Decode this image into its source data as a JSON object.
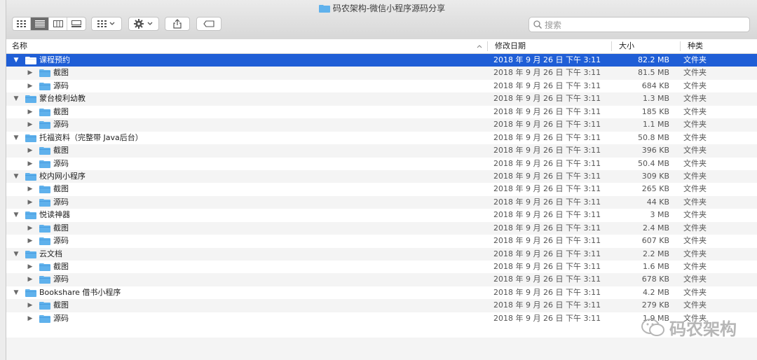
{
  "window": {
    "title": "码农架构-微信小程序源码分享"
  },
  "toolbar": {
    "search_placeholder": "搜索"
  },
  "columns": {
    "name": "名称",
    "date": "修改日期",
    "size": "大小",
    "kind": "种类"
  },
  "rows": [
    {
      "name": "课程预约",
      "date": "2018 年 9 月 26 日 下午 3:11",
      "size": "82.2 MB",
      "kind": "文件夹",
      "level": 0,
      "expanded": true,
      "selected": true
    },
    {
      "name": "截图",
      "date": "2018 年 9 月 26 日 下午 3:11",
      "size": "81.5 MB",
      "kind": "文件夹",
      "level": 1
    },
    {
      "name": "源码",
      "date": "2018 年 9 月 26 日 下午 3:11",
      "size": "684 KB",
      "kind": "文件夹",
      "level": 1
    },
    {
      "name": "蒙台梭利幼教",
      "date": "2018 年 9 月 26 日 下午 3:11",
      "size": "1.3 MB",
      "kind": "文件夹",
      "level": 0,
      "expanded": true
    },
    {
      "name": "截图",
      "date": "2018 年 9 月 26 日 下午 3:11",
      "size": "185 KB",
      "kind": "文件夹",
      "level": 1
    },
    {
      "name": "源码",
      "date": "2018 年 9 月 26 日 下午 3:11",
      "size": "1.1 MB",
      "kind": "文件夹",
      "level": 1
    },
    {
      "name": "托福资料（完整带 Java后台）",
      "date": "2018 年 9 月 26 日 下午 3:11",
      "size": "50.8 MB",
      "kind": "文件夹",
      "level": 0,
      "expanded": true
    },
    {
      "name": "截图",
      "date": "2018 年 9 月 26 日 下午 3:11",
      "size": "396 KB",
      "kind": "文件夹",
      "level": 1
    },
    {
      "name": "源码",
      "date": "2018 年 9 月 26 日 下午 3:11",
      "size": "50.4 MB",
      "kind": "文件夹",
      "level": 1
    },
    {
      "name": "校内网小程序",
      "date": "2018 年 9 月 26 日 下午 3:11",
      "size": "309 KB",
      "kind": "文件夹",
      "level": 0,
      "expanded": true
    },
    {
      "name": "截图",
      "date": "2018 年 9 月 26 日 下午 3:11",
      "size": "265 KB",
      "kind": "文件夹",
      "level": 1
    },
    {
      "name": "源码",
      "date": "2018 年 9 月 26 日 下午 3:11",
      "size": "44 KB",
      "kind": "文件夹",
      "level": 1
    },
    {
      "name": "悦读神器",
      "date": "2018 年 9 月 26 日 下午 3:11",
      "size": "3 MB",
      "kind": "文件夹",
      "level": 0,
      "expanded": true
    },
    {
      "name": "截图",
      "date": "2018 年 9 月 26 日 下午 3:11",
      "size": "2.4 MB",
      "kind": "文件夹",
      "level": 1
    },
    {
      "name": "源码",
      "date": "2018 年 9 月 26 日 下午 3:11",
      "size": "607 KB",
      "kind": "文件夹",
      "level": 1
    },
    {
      "name": "云文档",
      "date": "2018 年 9 月 26 日 下午 3:11",
      "size": "2.2 MB",
      "kind": "文件夹",
      "level": 0,
      "expanded": true
    },
    {
      "name": "截图",
      "date": "2018 年 9 月 26 日 下午 3:11",
      "size": "1.6 MB",
      "kind": "文件夹",
      "level": 1
    },
    {
      "name": "源码",
      "date": "2018 年 9 月 26 日 下午 3:11",
      "size": "678 KB",
      "kind": "文件夹",
      "level": 1
    },
    {
      "name": "Bookshare 借书小程序",
      "date": "2018 年 9 月 26 日 下午 3:11",
      "size": "4.2 MB",
      "kind": "文件夹",
      "level": 0,
      "expanded": true
    },
    {
      "name": "截图",
      "date": "2018 年 9 月 26 日 下午 3:11",
      "size": "279 KB",
      "kind": "文件夹",
      "level": 1
    },
    {
      "name": "源码",
      "date": "2018 年 9 月 26 日 下午 3:11",
      "size": "1.9 MB",
      "kind": "文件夹",
      "level": 1
    }
  ],
  "watermark": {
    "text": "码农架构"
  },
  "colors": {
    "selection": "#1f5ed6",
    "folder": "#5fb1ec"
  }
}
